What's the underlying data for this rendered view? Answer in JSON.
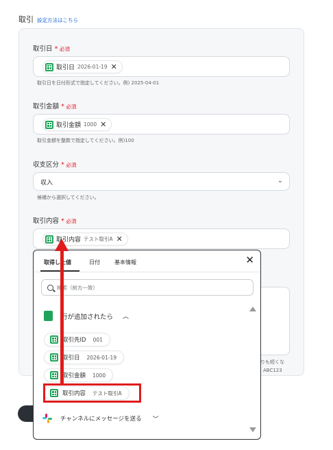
{
  "section": {
    "title": "取引",
    "help_link": "設定方法はこちら"
  },
  "required_label": "必須",
  "fields": {
    "date": {
      "label": "取引日",
      "chip_label": "取引日",
      "chip_value": "2026-01-19",
      "hint": "取引日を日付形式で指定してください。例) 2025-04-01"
    },
    "amount": {
      "label": "取引金額",
      "chip_label": "取引金額",
      "chip_value": "1000",
      "hint": "取引金額を整数で指定してください。例)100"
    },
    "type": {
      "label": "収支区分",
      "selected": "収入",
      "hint": "候補から選択してください。"
    },
    "content": {
      "label": "取引内容",
      "chip_label": "取引内容",
      "chip_value": "テスト取引A"
    }
  },
  "behind": {
    "line1": "りも短くな",
    "line2": "ABC123"
  },
  "popup": {
    "tabs": [
      "取得した値",
      "日付",
      "基本情報"
    ],
    "search_placeholder": "検索（前方一致）",
    "group_title": "行が追加されたら",
    "options": [
      {
        "label": "取引先ID",
        "value": "001"
      },
      {
        "label": "取引日",
        "value": "2026-01-19"
      },
      {
        "label": "取引金額",
        "value": "1000"
      },
      {
        "label": "取引内容",
        "value": "テスト取引A"
      }
    ],
    "slack_group": "チャンネルにメッセージを送る"
  },
  "colors": {
    "accent_red": "#e11b1b",
    "sheet_green": "#20a35a",
    "link_blue": "#2a6fdb"
  },
  "icons": {
    "sheet": "google-sheets-icon",
    "slack": "slack-icon",
    "close": "close-icon",
    "search": "search-icon"
  }
}
